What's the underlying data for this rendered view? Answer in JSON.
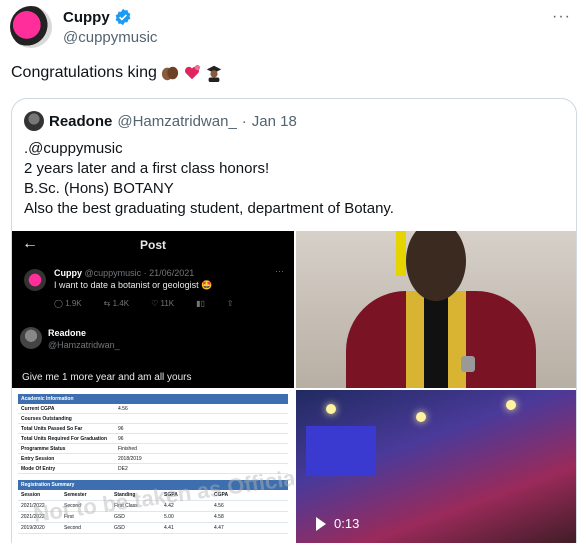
{
  "tweet": {
    "display_name": "Cuppy",
    "handle": "@cuppymusic",
    "text": "Congratulations king",
    "emojis": [
      "hands-icon",
      "hearts-icon",
      "graduate-icon"
    ]
  },
  "quote": {
    "display_name": "Readone",
    "handle": "@Hamzatridwan_",
    "separator": "·",
    "date": "Jan 18",
    "lines": [
      ".@cuppymusic",
      "2 years later and a first class honors!",
      "B.Sc. (Hons) BOTANY",
      "Also the best graduating student, department of Botany."
    ]
  },
  "media": {
    "screenshot": {
      "header_title": "Post",
      "post_name": "Cuppy",
      "post_meta": "@cuppymusic · 21/06/2021",
      "post_text": "I want to date a botanist or geologist 🤩",
      "stats": [
        "1.9K",
        "1.4K",
        "11K"
      ],
      "reply_name": "Readone",
      "reply_handle": "@Hamzatridwan_",
      "reply_text": "Give me 1 more year and am all yours"
    },
    "results": {
      "academic_header": "Academic Information",
      "rows": [
        {
          "k": "Current CGPA",
          "v": "4.56"
        },
        {
          "k": "Courses Outstanding",
          "v": ""
        },
        {
          "k": "Total Units Passed So Far",
          "v": "96"
        },
        {
          "k": "Total Units Required For Graduation",
          "v": "96"
        },
        {
          "k": "Programme Status",
          "v": "Finished"
        },
        {
          "k": "Entry Session",
          "v": "2018/2019"
        },
        {
          "k": "Mode Of Entry",
          "v": "DE2"
        }
      ],
      "summary_header": "Registration Summary",
      "summary_columns": [
        "Session",
        "Semester",
        "Standing",
        "SGPA",
        "CGPA"
      ],
      "summary_rows": [
        [
          "2021/2022",
          "Second",
          "First Class",
          "4.42",
          "4.56"
        ],
        [
          "2021/2022",
          "First",
          "GSD",
          "5.00",
          "4.58"
        ],
        [
          "2019/2020",
          "Second",
          "GSD",
          "4.41",
          "4.47"
        ]
      ],
      "watermark": "Not to be taken as Official Result"
    },
    "video": {
      "duration": "0:13"
    }
  }
}
